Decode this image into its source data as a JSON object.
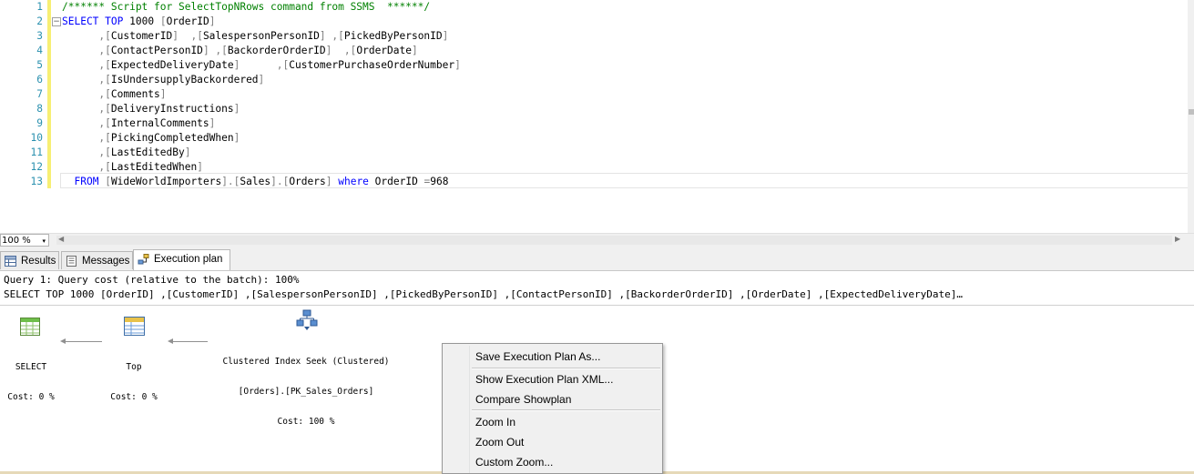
{
  "editor": {
    "lines": [
      {
        "n": "1",
        "parts": [
          {
            "c": "cm",
            "t": "/****** Script for SelectTopNRows command from SSMS  ******/"
          }
        ]
      },
      {
        "n": "2",
        "parts": [
          {
            "c": "kw",
            "t": "SELECT"
          },
          {
            "c": "tx",
            "t": " "
          },
          {
            "c": "kw",
            "t": "TOP"
          },
          {
            "c": "tx",
            "t": " 1000 "
          },
          {
            "c": "gr",
            "t": "["
          },
          {
            "c": "id",
            "t": "OrderID"
          },
          {
            "c": "gr",
            "t": "]"
          }
        ]
      },
      {
        "n": "3",
        "parts": [
          {
            "c": "gr",
            "t": "      ,["
          },
          {
            "c": "id",
            "t": "CustomerID"
          },
          {
            "c": "gr",
            "t": "]  ,["
          },
          {
            "c": "id",
            "t": "SalespersonPersonID"
          },
          {
            "c": "gr",
            "t": "] ,["
          },
          {
            "c": "id",
            "t": "PickedByPersonID"
          },
          {
            "c": "gr",
            "t": "]"
          }
        ]
      },
      {
        "n": "4",
        "parts": [
          {
            "c": "gr",
            "t": "      ,["
          },
          {
            "c": "id",
            "t": "ContactPersonID"
          },
          {
            "c": "gr",
            "t": "] ,["
          },
          {
            "c": "id",
            "t": "BackorderOrderID"
          },
          {
            "c": "gr",
            "t": "]  ,["
          },
          {
            "c": "id",
            "t": "OrderDate"
          },
          {
            "c": "gr",
            "t": "]"
          }
        ]
      },
      {
        "n": "5",
        "parts": [
          {
            "c": "gr",
            "t": "      ,["
          },
          {
            "c": "id",
            "t": "ExpectedDeliveryDate"
          },
          {
            "c": "gr",
            "t": "]      ,["
          },
          {
            "c": "id",
            "t": "CustomerPurchaseOrderNumber"
          },
          {
            "c": "gr",
            "t": "]"
          }
        ]
      },
      {
        "n": "6",
        "parts": [
          {
            "c": "gr",
            "t": "      ,["
          },
          {
            "c": "id",
            "t": "IsUndersupplyBackordered"
          },
          {
            "c": "gr",
            "t": "]"
          }
        ]
      },
      {
        "n": "7",
        "parts": [
          {
            "c": "gr",
            "t": "      ,["
          },
          {
            "c": "id",
            "t": "Comments"
          },
          {
            "c": "gr",
            "t": "]"
          }
        ]
      },
      {
        "n": "8",
        "parts": [
          {
            "c": "gr",
            "t": "      ,["
          },
          {
            "c": "id",
            "t": "DeliveryInstructions"
          },
          {
            "c": "gr",
            "t": "]"
          }
        ]
      },
      {
        "n": "9",
        "parts": [
          {
            "c": "gr",
            "t": "      ,["
          },
          {
            "c": "id",
            "t": "InternalComments"
          },
          {
            "c": "gr",
            "t": "]"
          }
        ]
      },
      {
        "n": "10",
        "parts": [
          {
            "c": "gr",
            "t": "      ,["
          },
          {
            "c": "id",
            "t": "PickingCompletedWhen"
          },
          {
            "c": "gr",
            "t": "]"
          }
        ]
      },
      {
        "n": "11",
        "parts": [
          {
            "c": "gr",
            "t": "      ,["
          },
          {
            "c": "id",
            "t": "LastEditedBy"
          },
          {
            "c": "gr",
            "t": "]"
          }
        ]
      },
      {
        "n": "12",
        "parts": [
          {
            "c": "gr",
            "t": "      ,["
          },
          {
            "c": "id",
            "t": "LastEditedWhen"
          },
          {
            "c": "gr",
            "t": "]"
          }
        ]
      },
      {
        "n": "13",
        "parts": [
          {
            "c": "tx",
            "t": "  "
          },
          {
            "c": "kw",
            "t": "FROM"
          },
          {
            "c": "tx",
            "t": " "
          },
          {
            "c": "gr",
            "t": "["
          },
          {
            "c": "id",
            "t": "WideWorldImporters"
          },
          {
            "c": "gr",
            "t": "].["
          },
          {
            "c": "id",
            "t": "Sales"
          },
          {
            "c": "gr",
            "t": "].["
          },
          {
            "c": "id",
            "t": "Orders"
          },
          {
            "c": "gr",
            "t": "]"
          },
          {
            "c": "tx",
            "t": " "
          },
          {
            "c": "kw",
            "t": "where"
          },
          {
            "c": "tx",
            "t": " OrderID "
          },
          {
            "c": "gr",
            "t": "="
          },
          {
            "c": "tx",
            "t": "968"
          }
        ]
      }
    ],
    "fold_glyph": "−"
  },
  "zoom": {
    "value": "100 %",
    "arrow": "▾"
  },
  "tabs": [
    {
      "label": "Results",
      "icon": "grid-icon"
    },
    {
      "label": "Messages",
      "icon": "messages-icon"
    },
    {
      "label": "Execution plan",
      "icon": "execution-plan-icon"
    }
  ],
  "plan": {
    "query_header": "Query 1: Query cost (relative to the batch): 100%",
    "query_sql": "SELECT TOP 1000 [OrderID] ,[CustomerID] ,[SalespersonPersonID] ,[PickedByPersonID] ,[ContactPersonID] ,[BackorderOrderID] ,[OrderDate] ,[ExpectedDeliveryDate]…",
    "nodes": [
      {
        "name": "SELECT",
        "cost": "Cost: 0 %",
        "icon": "select-operator-icon"
      },
      {
        "name": "Top",
        "cost": "Cost: 0 %",
        "icon": "top-operator-icon"
      },
      {
        "name": "Clustered Index Seek (Clustered)",
        "object": "[Orders].[PK_Sales_Orders]",
        "cost": "Cost: 100 %",
        "icon": "clustered-index-seek-icon"
      }
    ]
  },
  "context_menu": {
    "items": [
      "Save Execution Plan As...",
      "Show Execution Plan XML...",
      "Compare Showplan",
      "Zoom In",
      "Zoom Out",
      "Custom Zoom..."
    ]
  }
}
